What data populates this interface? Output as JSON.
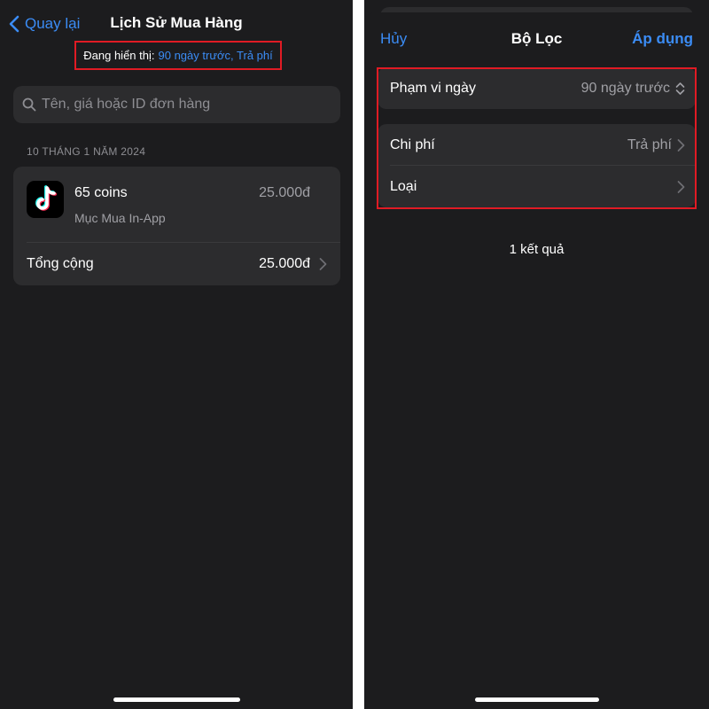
{
  "purchase_history": {
    "back_label": "Quay lại",
    "title": "Lịch Sử Mua Hàng",
    "showing_label": "Đang hiển thị:",
    "showing_value": "90 ngày trước, Trả phí",
    "search_placeholder": "Tên, giá hoặc ID đơn hàng",
    "section_date": "10 THÁNG 1 NĂM 2024",
    "item": {
      "name": "65 coins",
      "price": "25.000đ",
      "subtitle": "Mục Mua In-App",
      "app_icon": "tiktok-logo"
    },
    "total_label": "Tổng cộng",
    "total_value": "25.000đ"
  },
  "filter_sheet": {
    "cancel_label": "Hủy",
    "title": "Bộ Lọc",
    "apply_label": "Áp dụng",
    "rows": [
      {
        "label": "Phạm vi ngày",
        "value": "90 ngày trước",
        "icon": "updown-chevron-icon"
      },
      {
        "label": "Chi phí",
        "value": "Trả phí",
        "icon": "chevron-right-icon"
      },
      {
        "label": "Loại",
        "value": "",
        "icon": "chevron-right-icon"
      }
    ],
    "results_text": "1 kết quả"
  },
  "colors": {
    "background": "#1c1c1e",
    "card": "#2c2c2e",
    "accent": "#3b8cf5",
    "highlight": "#e01b24"
  }
}
